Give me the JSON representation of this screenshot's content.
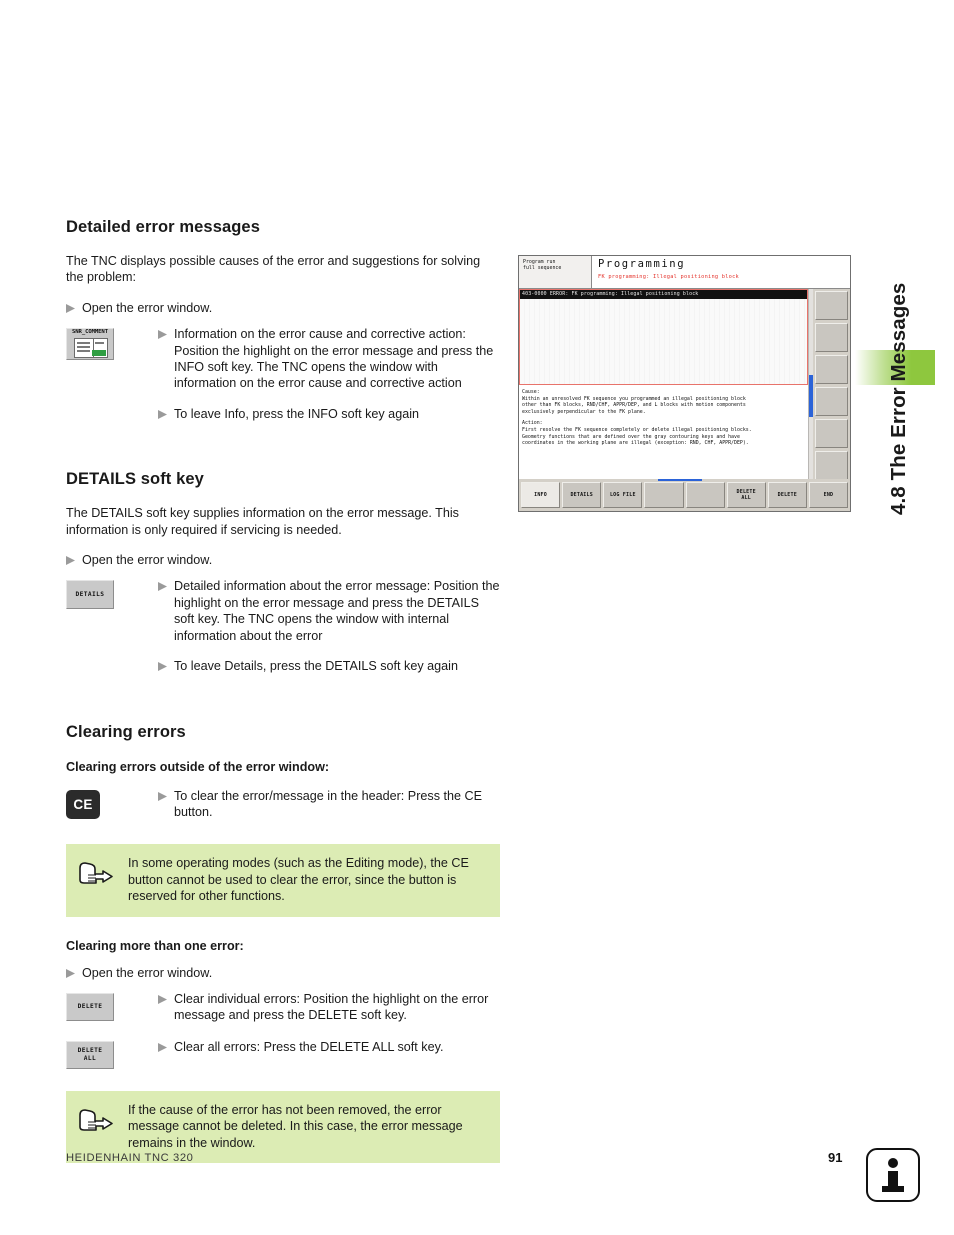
{
  "side_tab": {
    "label": "4.8 The Error Messages",
    "band_color": "#8ec73e"
  },
  "sections": {
    "detailed": {
      "heading": "Detailed error messages",
      "intro": "The TNC displays possible causes of the error and suggestions for solving the problem:",
      "open_window": "Open the error window.",
      "key_label": "SNR_COMMENT",
      "item1": "Information on the error cause and corrective action: Position the highlight on the error message and press the INFO soft key. The TNC opens the window with information on the error cause and corrective action",
      "item2": "To leave Info, press the INFO soft key again"
    },
    "details": {
      "heading": "DETAILS soft key",
      "intro": "The DETAILS soft key supplies information on the error message. This information is only required if servicing is needed.",
      "open_window": "Open the error window.",
      "key_label": "DETAILS",
      "item1": "Detailed information about the error message: Position the highlight on the error message and press the DETAILS soft key. The TNC opens the window with internal information about the error",
      "item2": "To leave Details, press the DETAILS soft key again"
    },
    "clearing": {
      "heading": "Clearing errors",
      "sub_outside": "Clearing errors outside of the error window:",
      "ce_key_label": "CE",
      "ce_text": "To clear the error/message in the header: Press the CE button.",
      "note1": "In some operating modes (such as the Editing mode), the CE button cannot be used to clear the error, since the button is reserved for other functions.",
      "sub_more": "Clearing more than one error:",
      "open_window": "Open the error window.",
      "delete_key_label": "DELETE",
      "delete_text": "Clear individual errors: Position the highlight on the error message and press the DELETE soft key.",
      "delete_all_key_line1": "DELETE",
      "delete_all_key_line2": "ALL",
      "delete_all_text": "Clear all errors: Press the DELETE ALL soft key.",
      "note2": "If the cause of the error has not been removed, the error message cannot be deleted. In this case, the error message remains in the window."
    }
  },
  "tnc_screen": {
    "mode_line1": "Program run",
    "mode_line2": "full sequence",
    "title": "Programming",
    "status_error": "FK programming: Illegal positioning block",
    "error_row": "403-0000 ERROR:  FK programming: Illegal positioning block",
    "cause_label": "Cause:",
    "cause_lines": [
      "Within an unresolved FK sequence you programmed an illegal positioning block",
      "other than FK blocks, RND/CHF, APPR/DEP, and L blocks with motion components",
      "exclusively perpendicular to the FK plane."
    ],
    "action_label": "Action:",
    "action_lines": [
      "First resolve the FK sequence completely or delete illegal positioning blocks.",
      "Geometry functions that are defined over the gray contouring keys and have",
      "coordinates in the working plane are illegal (exception: RND, CHF, APPR/DEP)."
    ],
    "soft_keys": [
      {
        "label": "INFO",
        "active": true
      },
      {
        "label": "DETAILS",
        "active": false
      },
      {
        "label": "LOG FILE",
        "active": false
      },
      {
        "label": "",
        "active": false
      },
      {
        "label": "",
        "active": false
      },
      {
        "label": "DELETE\nALL",
        "active": false
      },
      {
        "label": "DELETE",
        "active": false
      },
      {
        "label": "END",
        "active": false
      }
    ],
    "vertical_keys": [
      "",
      "",
      "",
      "",
      "",
      ""
    ]
  },
  "footer": {
    "product": "HEIDENHAIN TNC 320",
    "page_number": "91"
  }
}
